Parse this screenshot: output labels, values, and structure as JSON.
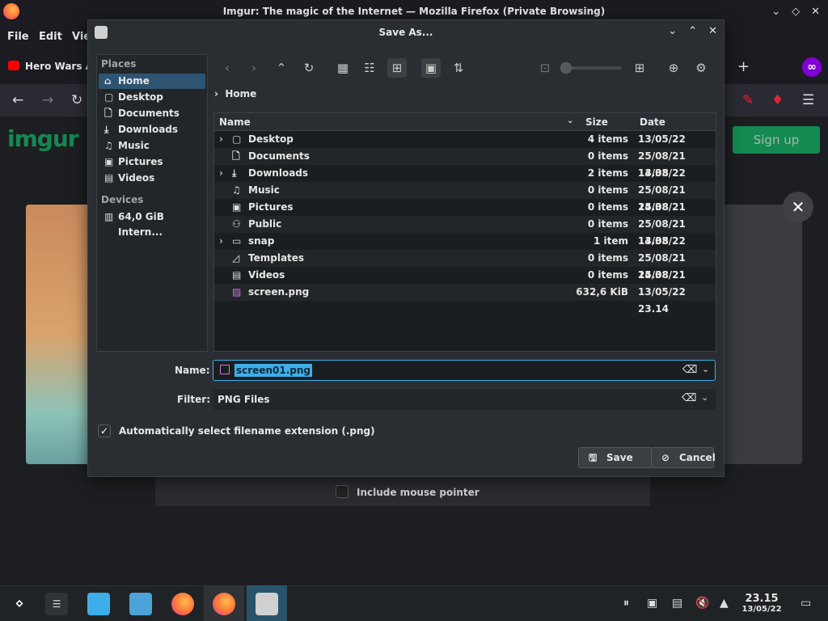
{
  "firefox": {
    "window_title": "Imgur: The magic of the Internet — Mozilla Firefox (Private Browsing)",
    "menu": [
      "File",
      "Edit",
      "Vie"
    ],
    "tab_label": "Hero Wars A",
    "new_tab": "+"
  },
  "page": {
    "logo": "imgur",
    "signup": "Sign up",
    "close": "✕",
    "mouse_pointer_label": "Include mouse pointer"
  },
  "dialog": {
    "title": "Save As...",
    "places_header": "Places",
    "devices_header": "Devices",
    "places": [
      {
        "label": "Home",
        "icon": "home-icon"
      },
      {
        "label": "Desktop",
        "icon": "desktop-icon"
      },
      {
        "label": "Documents",
        "icon": "documents-icon"
      },
      {
        "label": "Downloads",
        "icon": "downloads-icon"
      },
      {
        "label": "Music",
        "icon": "music-icon"
      },
      {
        "label": "Pictures",
        "icon": "pictures-icon"
      },
      {
        "label": "Videos",
        "icon": "videos-icon"
      }
    ],
    "devices": [
      {
        "label": "64,0 GiB Intern...",
        "icon": "drive-icon"
      }
    ],
    "breadcrumb": "Home",
    "columns": {
      "name": "Name",
      "size": "Size",
      "date": "Date"
    },
    "files": [
      {
        "name": "Desktop",
        "size": "4 items",
        "date": "13/05/22 22.50",
        "expandable": true,
        "icon": "desktop-icon"
      },
      {
        "name": "Documents",
        "size": "0 items",
        "date": "25/08/21 14.38",
        "expandable": false,
        "icon": "documents-icon"
      },
      {
        "name": "Downloads",
        "size": "2 items",
        "date": "13/05/22 22.54",
        "expandable": true,
        "icon": "downloads-icon"
      },
      {
        "name": "Music",
        "size": "0 items",
        "date": "25/08/21 14.38",
        "expandable": false,
        "icon": "music-icon"
      },
      {
        "name": "Pictures",
        "size": "0 items",
        "date": "25/08/21 14.38",
        "expandable": false,
        "icon": "pictures-icon"
      },
      {
        "name": "Public",
        "size": "0 items",
        "date": "25/08/21 14.38",
        "expandable": false,
        "icon": "public-icon"
      },
      {
        "name": "snap",
        "size": "1 item",
        "date": "13/05/22 21.49",
        "expandable": true,
        "icon": "folder-icon"
      },
      {
        "name": "Templates",
        "size": "0 items",
        "date": "25/08/21 14.38",
        "expandable": false,
        "icon": "templates-icon"
      },
      {
        "name": "Videos",
        "size": "0 items",
        "date": "25/08/21 14.38",
        "expandable": false,
        "icon": "videos-icon"
      },
      {
        "name": "screen.png",
        "size": "632,6 KiB",
        "date": "13/05/22 23.14",
        "expandable": false,
        "icon": "image-file-icon"
      }
    ],
    "name_label": "Name:",
    "name_value": "screen01.png",
    "filter_label": "Filter:",
    "filter_value": "PNG Files",
    "auto_ext_label": "Automatically select filename extension (.png)",
    "auto_ext_checked": true,
    "save_label": "Save",
    "cancel_label": "Cancel"
  },
  "taskbar": {
    "time": "23.15",
    "date": "13/05/22"
  },
  "colors": {
    "accent": "#3daee9",
    "selection": "#2f5472",
    "imgur_green": "#1bb76e"
  }
}
